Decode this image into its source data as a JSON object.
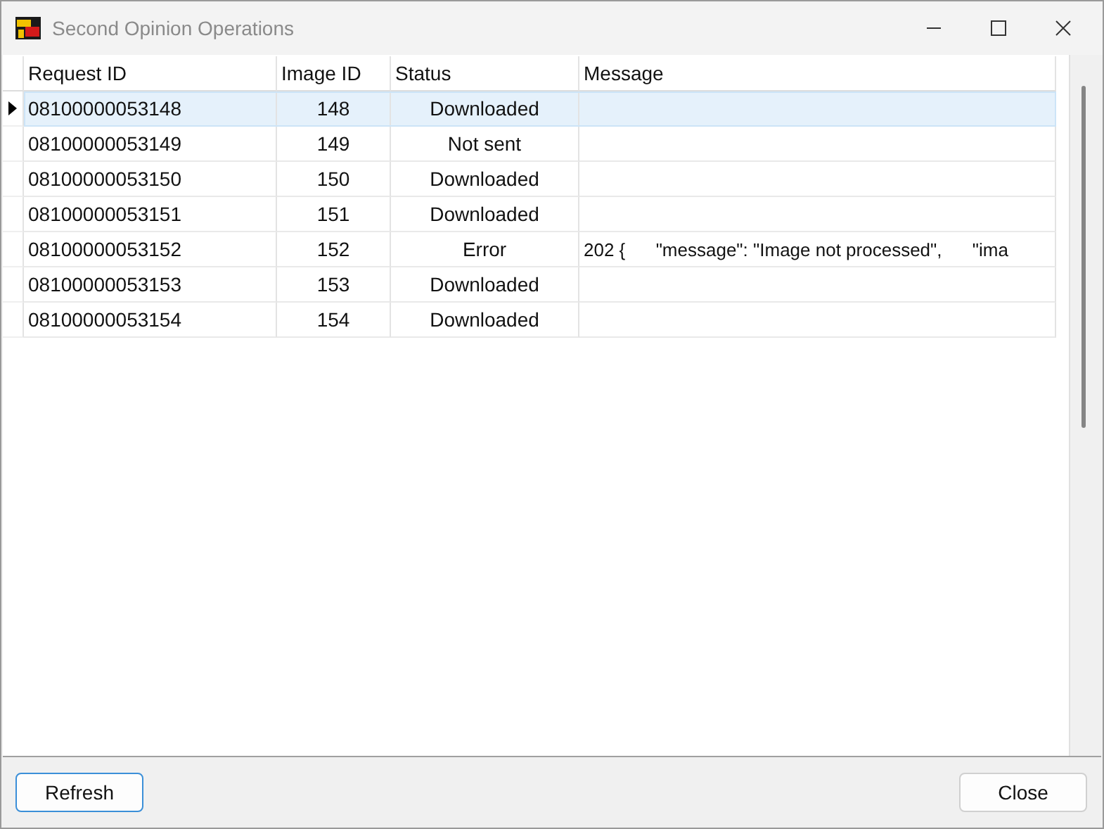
{
  "window": {
    "title": "Second Opinion Operations"
  },
  "table": {
    "columns": [
      "Request ID",
      "Image ID",
      "Status",
      "Message"
    ],
    "rows": [
      {
        "request_id": "08100000053148",
        "image_id": "148",
        "status": "Downloaded",
        "selected": true
      },
      {
        "request_id": "08100000053149",
        "image_id": "149",
        "status": "Not sent",
        "selected": false
      },
      {
        "request_id": "08100000053150",
        "image_id": "150",
        "status": "Downloaded",
        "selected": false
      },
      {
        "request_id": "08100000053151",
        "image_id": "151",
        "status": "Downloaded",
        "selected": false
      },
      {
        "request_id": "08100000053152",
        "image_id": "152",
        "status": "Error",
        "message": "202 {      \"message\": \"Image not processed\",      \"ima",
        "selected": false
      },
      {
        "request_id": "08100000053153",
        "image_id": "153",
        "status": "Downloaded",
        "selected": false
      },
      {
        "request_id": "08100000053154",
        "image_id": "154",
        "status": "Downloaded",
        "selected": false
      }
    ]
  },
  "buttons": [
    {
      "label": "Refresh",
      "kind": "default"
    },
    {
      "label": "Close",
      "kind": "normal"
    }
  ]
}
